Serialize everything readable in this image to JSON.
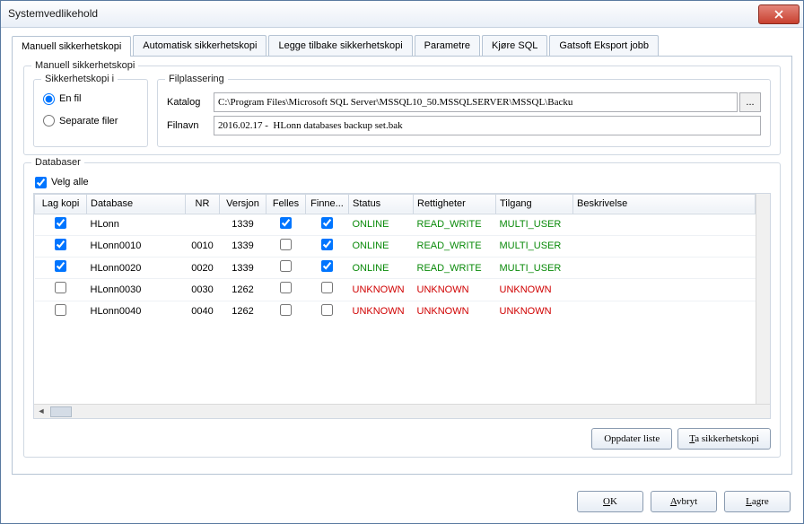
{
  "title": "Systemvedlikehold",
  "tabs": [
    {
      "label": "Manuell sikkerhetskopi",
      "active": true
    },
    {
      "label": "Automatisk sikkerhetskopi"
    },
    {
      "label": "Legge tilbake sikkerhetskopi"
    },
    {
      "label": "Parametre"
    },
    {
      "label": "Kjøre SQL"
    },
    {
      "label": "Gatsoft Eksport jobb"
    }
  ],
  "manual": {
    "group_label": "Manuell sikkerhetskopi",
    "target": {
      "label": "Sikkerhetskopi i",
      "one_file": "En fil",
      "separate": "Separate filer",
      "selected": "one"
    },
    "location": {
      "label": "Filplassering",
      "katalog_label": "Katalog",
      "katalog_value": "C:\\Program Files\\Microsoft SQL Server\\MSSQL10_50.MSSQLSERVER\\MSSQL\\Backu",
      "filnavn_label": "Filnavn",
      "filnavn_value": "2016.02.17 -  HLonn databases backup set.bak",
      "browse": "..."
    }
  },
  "databases": {
    "label": "Databaser",
    "select_all_label": "Velg alle",
    "select_all_checked": true,
    "columns": [
      "Lag kopi",
      "Database",
      "NR",
      "Versjon",
      "Felles",
      "Finne...",
      "Status",
      "Rettigheter",
      "Tilgang",
      "Beskrivelse"
    ],
    "rows": [
      {
        "copy": true,
        "db": "HLonn",
        "nr": "",
        "ver": "1339",
        "felles": true,
        "finne": true,
        "status": "ONLINE",
        "rett": "READ_WRITE",
        "tilgang": "MULTI_USER",
        "beskr": "",
        "class": "green"
      },
      {
        "copy": true,
        "db": "HLonn0010",
        "nr": "0010",
        "ver": "1339",
        "felles": false,
        "finne": true,
        "status": "ONLINE",
        "rett": "READ_WRITE",
        "tilgang": "MULTI_USER",
        "beskr": "",
        "class": "green"
      },
      {
        "copy": true,
        "db": "HLonn0020",
        "nr": "0020",
        "ver": "1339",
        "felles": false,
        "finne": true,
        "status": "ONLINE",
        "rett": "READ_WRITE",
        "tilgang": "MULTI_USER",
        "beskr": "",
        "class": "green"
      },
      {
        "copy": false,
        "db": "HLonn0030",
        "nr": "0030",
        "ver": "1262",
        "felles": false,
        "finne": false,
        "status": "UNKNOWN",
        "rett": "UNKNOWN",
        "tilgang": "UNKNOWN",
        "beskr": "",
        "class": "red"
      },
      {
        "copy": false,
        "db": "HLonn0040",
        "nr": "0040",
        "ver": "1262",
        "felles": false,
        "finne": false,
        "status": "UNKNOWN",
        "rett": "UNKNOWN",
        "tilgang": "UNKNOWN",
        "beskr": "",
        "class": "red"
      }
    ]
  },
  "actions": {
    "refresh": "Oppdater liste",
    "backup_prefix": "T",
    "backup_rest": "a sikkerhetskopi"
  },
  "footer": {
    "ok_prefix": "O",
    "ok_rest": "K",
    "cancel_prefix": "A",
    "cancel_rest": "vbryt",
    "save_prefix": "L",
    "save_rest": "agre"
  }
}
